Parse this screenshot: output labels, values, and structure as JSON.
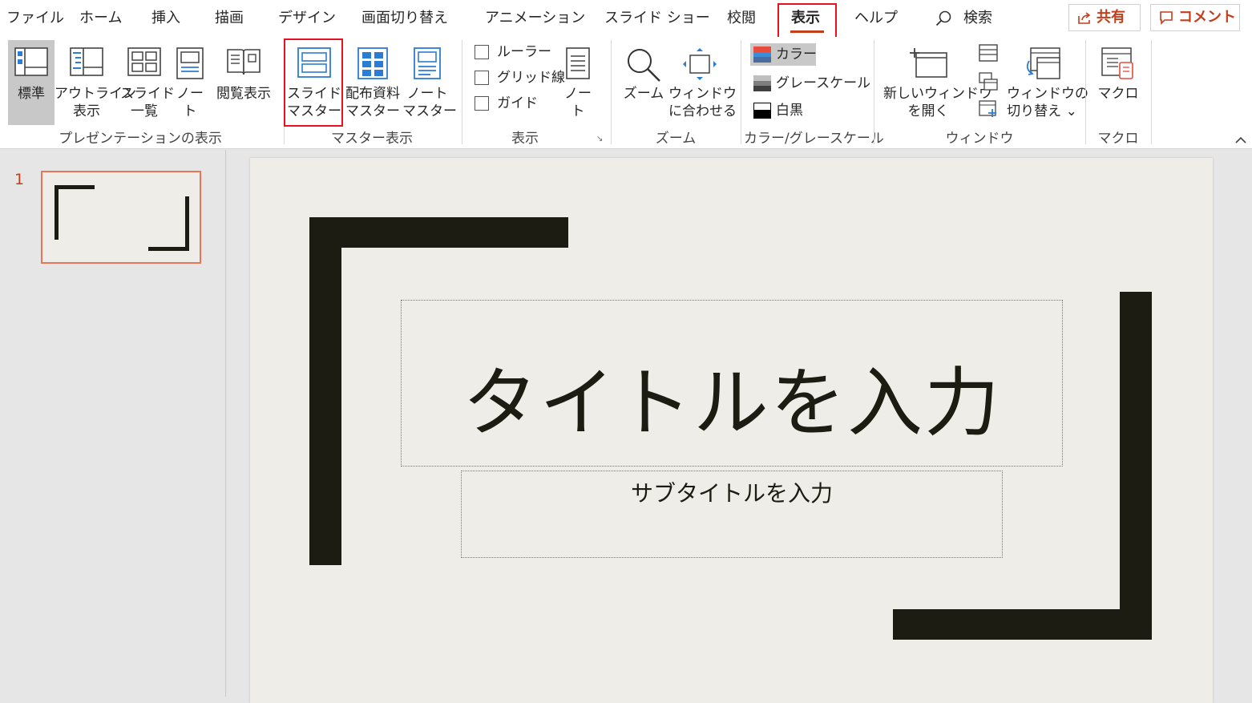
{
  "tabs": [
    {
      "label": "ファイル"
    },
    {
      "label": "ホーム"
    },
    {
      "label": "挿入"
    },
    {
      "label": "描画"
    },
    {
      "label": "デザイン"
    },
    {
      "label": "画面切り替え"
    },
    {
      "label": "アニメーション"
    },
    {
      "label": "スライド ショー"
    },
    {
      "label": "校閲"
    },
    {
      "label": "表示"
    },
    {
      "label": "ヘルプ"
    }
  ],
  "active_tab": "表示",
  "search": {
    "label": "検索"
  },
  "share_label": "共有",
  "comment_label": "コメント",
  "ribbon": {
    "presentation_views": {
      "group_label": "プレゼンテーションの表示",
      "normal": "標準",
      "outline_l1": "アウトライン",
      "outline_l2": "表示",
      "sorter_l1": "スライド",
      "sorter_l2": "一覧",
      "notes_l1": "ノー",
      "notes_l2": "ト",
      "reading": "閲覧表示"
    },
    "master_views": {
      "group_label": "マスター表示",
      "slide_master_l1": "スライド",
      "slide_master_l2": "マスター",
      "handout_master_l1": "配布資料",
      "handout_master_l2": "マスター",
      "notes_master_l1": "ノート",
      "notes_master_l2": "マスター"
    },
    "show": {
      "group_label": "表示",
      "ruler": "ルーラー",
      "gridlines": "グリッド線",
      "guides": "ガイド",
      "notes_l1": "ノー",
      "notes_l2": "ト"
    },
    "zoom": {
      "group_label": "ズーム",
      "zoom": "ズーム",
      "fit_l1": "ウィンドウ",
      "fit_l2": "に合わせる"
    },
    "color": {
      "group_label": "カラー/グレースケール",
      "color": "カラー",
      "grayscale": "グレースケール",
      "bw": "白黒"
    },
    "window": {
      "group_label": "ウィンドウ",
      "new_window_l1": "新しいウィンドウ",
      "new_window_l2": "を開く",
      "switch_l1": "ウィンドウの",
      "switch_l2": "切り替え ⌄"
    },
    "macros": {
      "group_label": "マクロ",
      "macros": "マクロ"
    }
  },
  "slide_pane": {
    "slide_number": "1"
  },
  "slide": {
    "title_placeholder": "タイトルを入力",
    "subtitle_placeholder": "サブタイトルを入力"
  },
  "colors": {
    "accent": "#c43e1c",
    "highlight": "#e81123",
    "slide_bg": "#efede7",
    "bar": "#1c1c12"
  },
  "icons": [
    "search-icon",
    "share-icon",
    "comment-icon",
    "normal-view-icon",
    "outline-view-icon",
    "slide-sorter-icon",
    "notes-page-icon",
    "reading-view-icon",
    "slide-master-icon",
    "handout-master-icon",
    "notes-master-icon",
    "notes-icon",
    "zoom-icon",
    "fit-to-window-icon",
    "new-window-icon",
    "arrange-all-icon",
    "cascade-icon",
    "move-split-icon",
    "switch-windows-icon",
    "macros-icon",
    "collapse-ribbon-icon"
  ]
}
